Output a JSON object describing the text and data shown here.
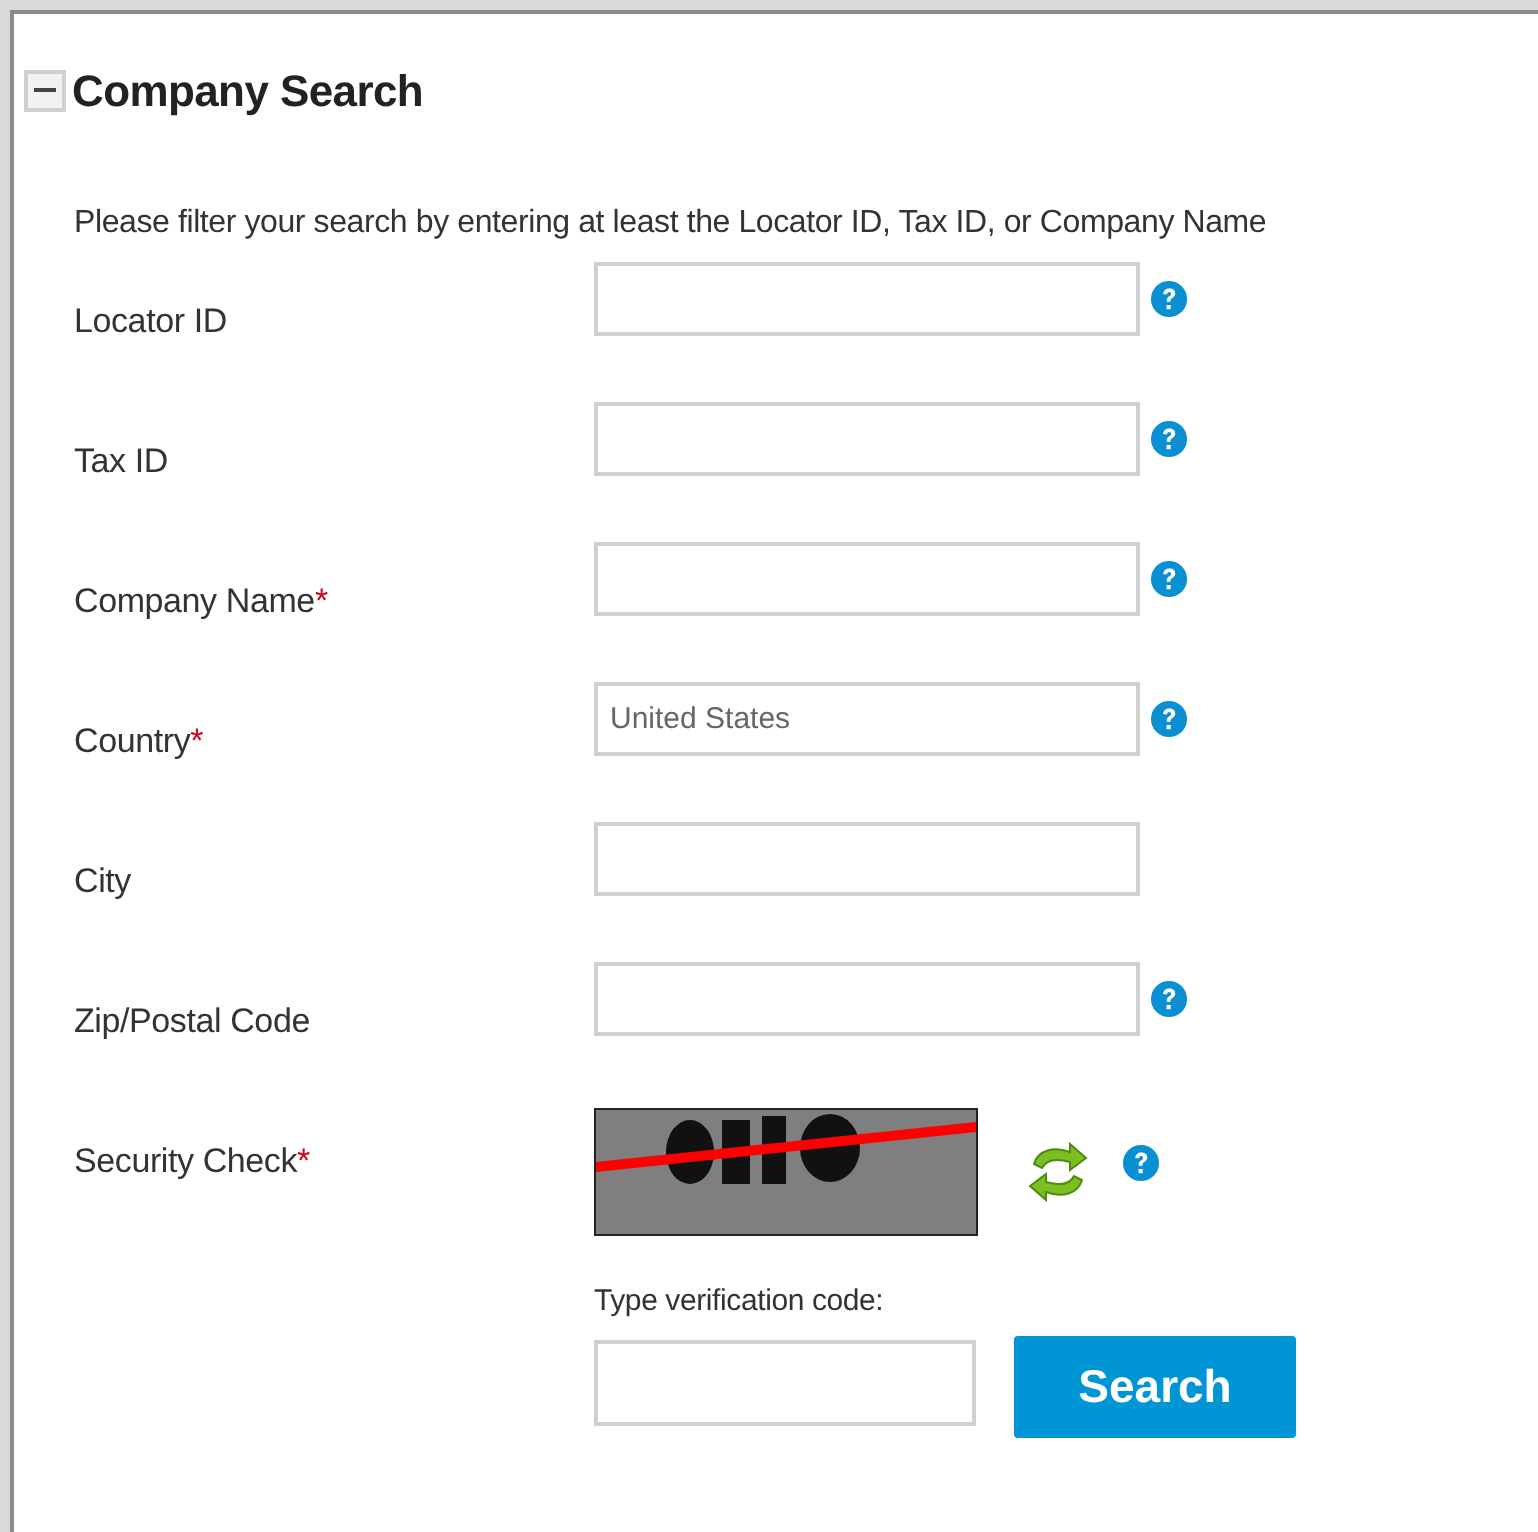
{
  "panel": {
    "title": "Company Search",
    "expanded": true
  },
  "instruction": "Please filter your search by entering at least the Locator ID, Tax ID, or Company Name",
  "fields": [
    {
      "kind": "text",
      "label": "Locator ID",
      "help": true
    },
    {
      "kind": "text",
      "label": "Tax ID",
      "help": true
    },
    {
      "kind": "text",
      "label": "Company Name",
      "required_mark": "*",
      "help": true
    },
    {
      "kind": "text",
      "label": "Country",
      "required_mark": "*",
      "value": "United States",
      "help": true
    },
    {
      "kind": "text",
      "label": "City",
      "help": false
    },
    {
      "kind": "text",
      "label": "Zip/Postal Code",
      "help": true
    },
    {
      "kind": "captcha",
      "label": "Security Check",
      "required_mark": "*",
      "help": true,
      "code_label": "Type verification code:"
    }
  ],
  "search_button": "Search"
}
